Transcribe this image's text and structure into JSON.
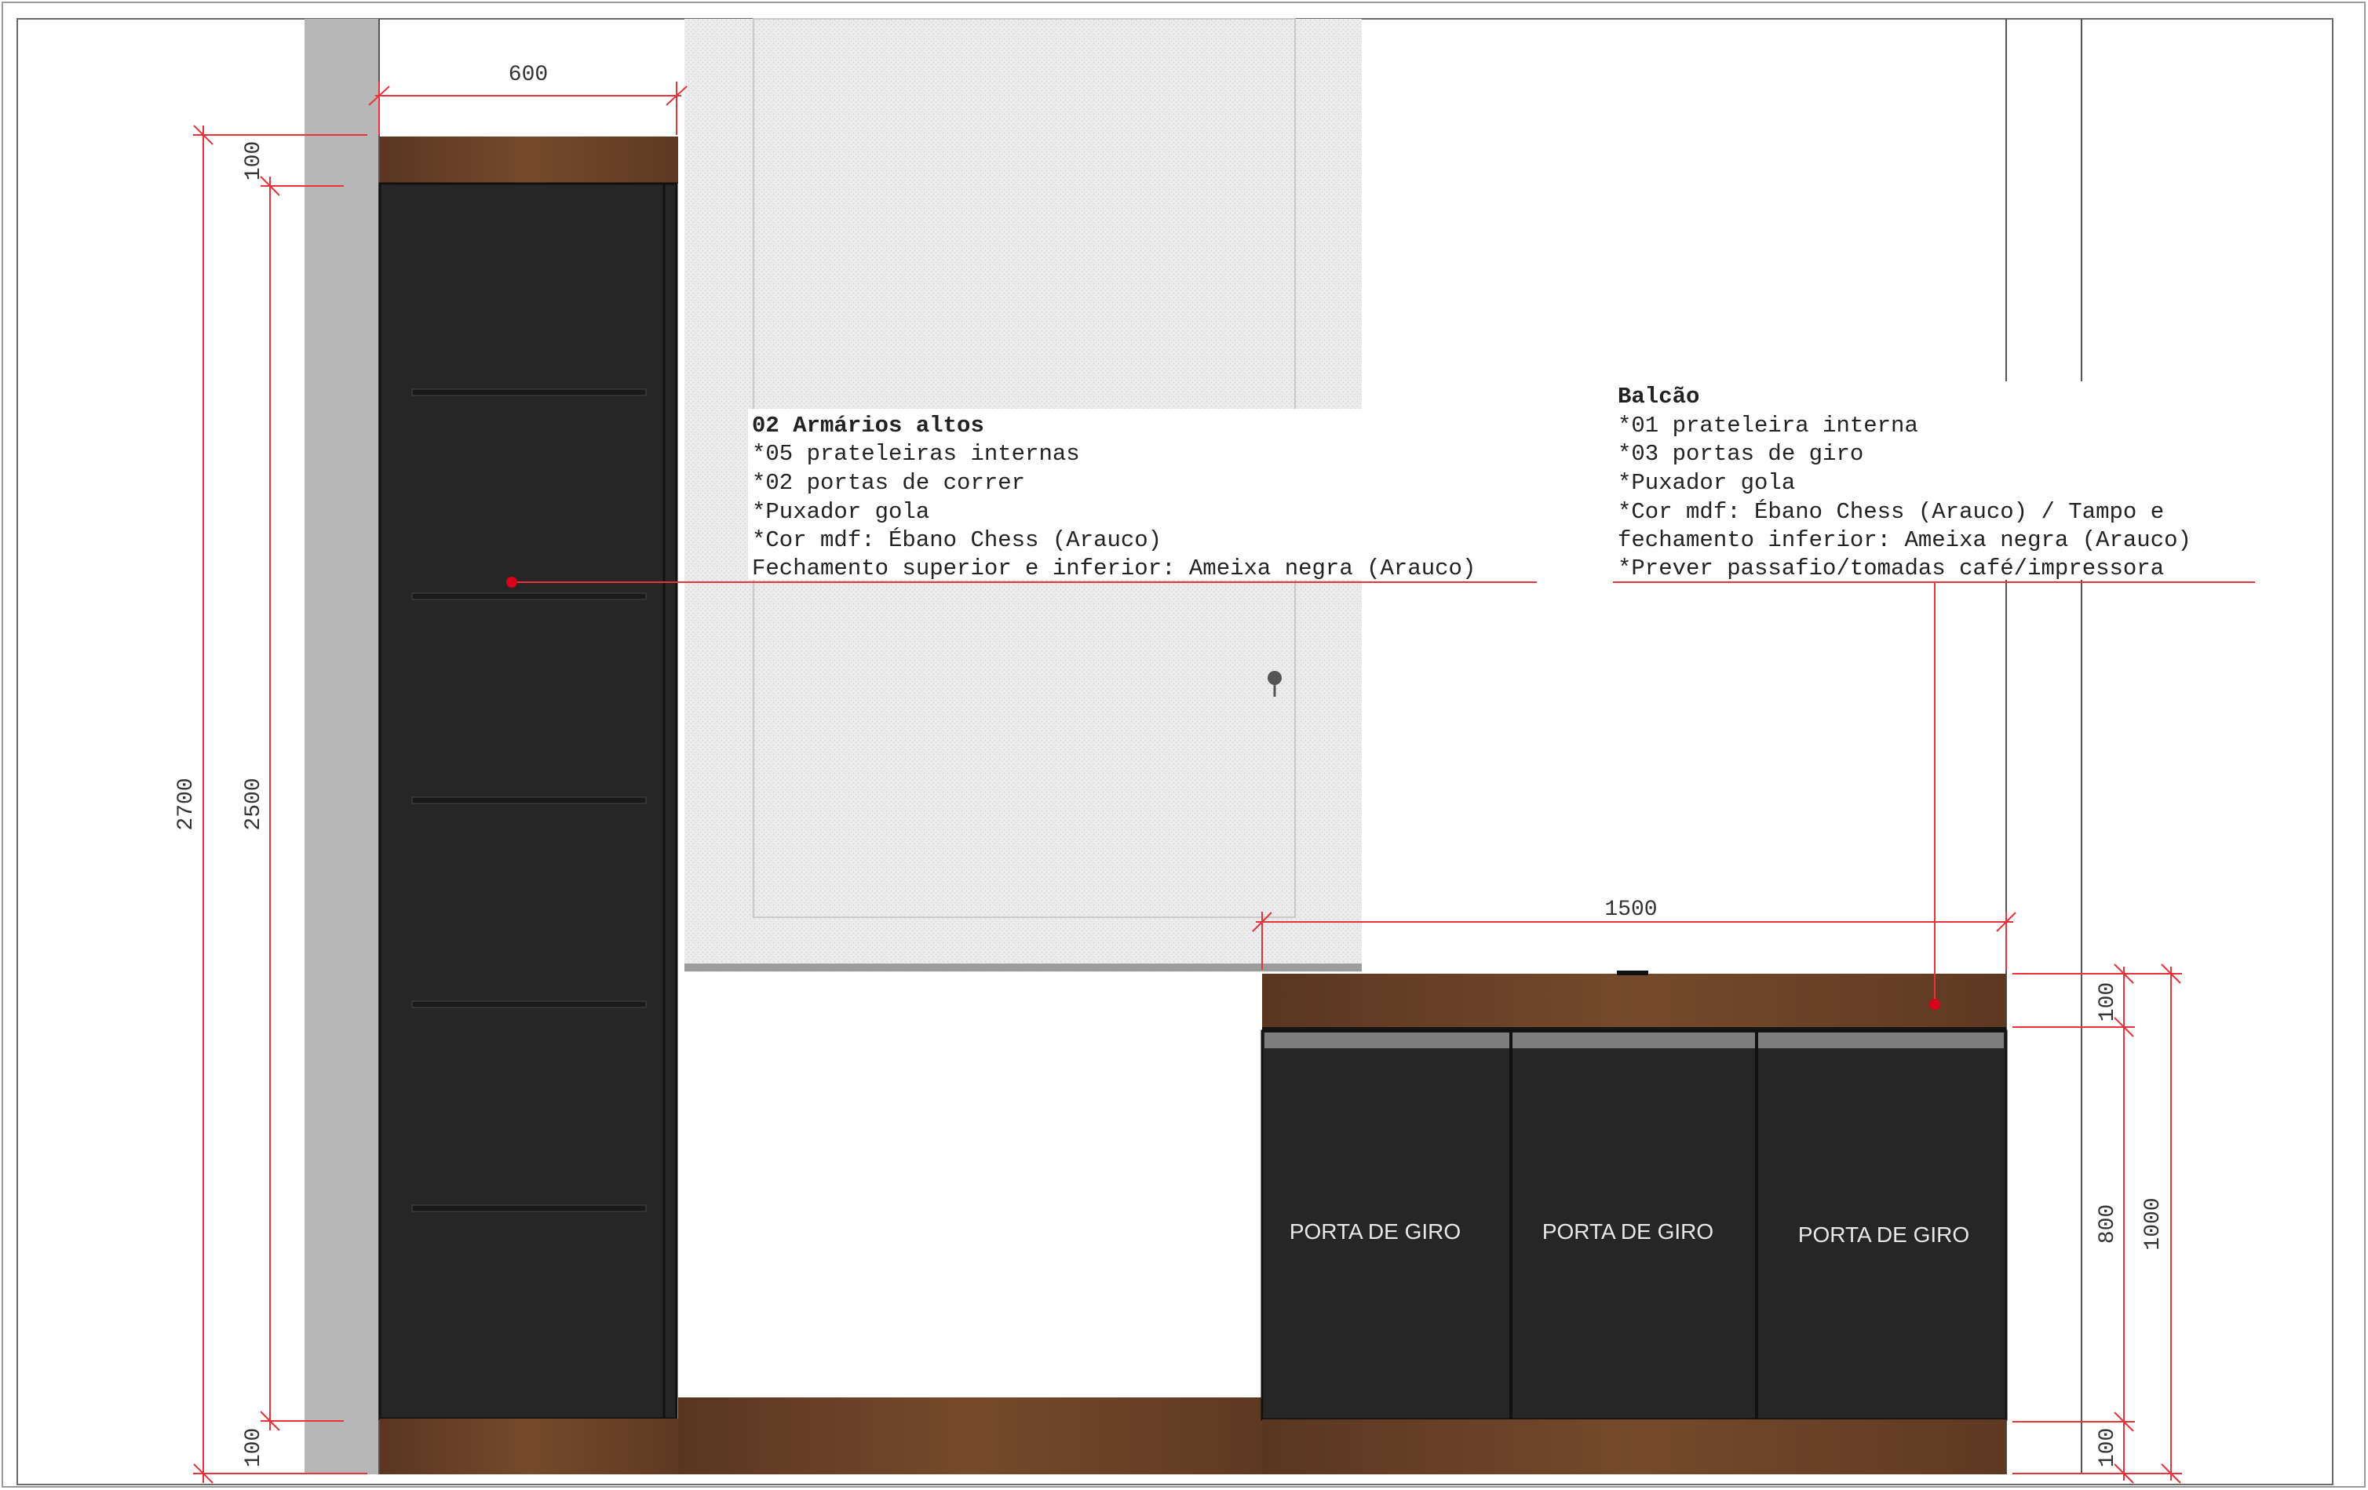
{
  "colors": {
    "wall": "#b5b5b5",
    "wood": "#6b4328",
    "mdf_black": "#2a2a2a",
    "dimension_line": "#e8333b",
    "marker": "#d8001b",
    "handle_strip": "#7a7a7a",
    "door_label": "#e8e8e8"
  },
  "dimensions": {
    "width_tall_cabinet": "600",
    "total_height": "2700",
    "tall_cabinet_height": "2500",
    "top_closure": "100",
    "bottom_closure": "100",
    "counter_width": "1500",
    "counter_top": "100",
    "counter_body": "800",
    "counter_total": "1000",
    "counter_base": "100"
  },
  "notes": {
    "tall_cabinets": {
      "title": "02 Armários altos",
      "lines": [
        "*05 prateleiras internas",
        "*02 portas de correr",
        "*Puxador gola",
        "*Cor mdf: Ébano Chess (Arauco)",
        "Fechamento superior e inferior: Ameixa negra (Arauco)"
      ]
    },
    "counter": {
      "title": "Balcão",
      "lines": [
        "*01 prateleira interna",
        "*03 portas de giro",
        "*Puxador gola",
        "*Cor mdf: Ébano Chess (Arauco) / Tampo e",
        "fechamento inferior: Ameixa negra (Arauco)",
        "*Prever passafio/tomadas café/impressora"
      ]
    }
  },
  "doors": {
    "door1": "PORTA DE GIRO",
    "door2": "PORTA DE GIRO",
    "door3": "PORTA DE GIRO"
  }
}
